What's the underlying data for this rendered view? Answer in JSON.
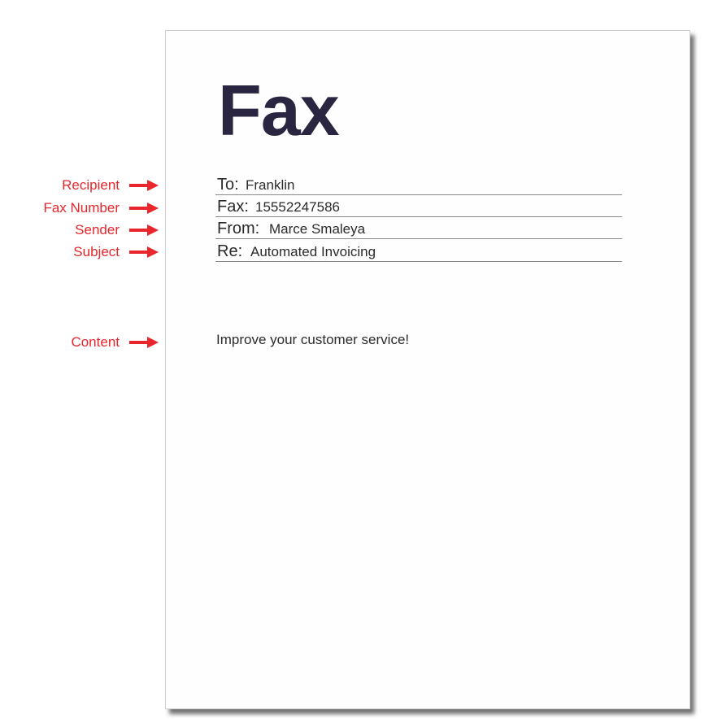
{
  "colors": {
    "annotation": "#e8262b",
    "title": "#2a2540",
    "text": "#2b2b2b"
  },
  "annotations": {
    "recipient": "Recipient",
    "fax_number": "Fax Number",
    "sender": "Sender",
    "subject": "Subject",
    "content": "Content",
    "arrow_icon": "right-arrow-icon"
  },
  "sheet": {
    "title": "Fax",
    "fields": {
      "to_label": "To:",
      "to_value": "Franklin",
      "fax_label": "Fax:",
      "fax_value": "15552247586",
      "from_label": "From:",
      "from_value": "Marce Smaleya",
      "re_label": "Re:",
      "re_value": "Automated Invoicing"
    },
    "content": "Improve your customer service!"
  }
}
